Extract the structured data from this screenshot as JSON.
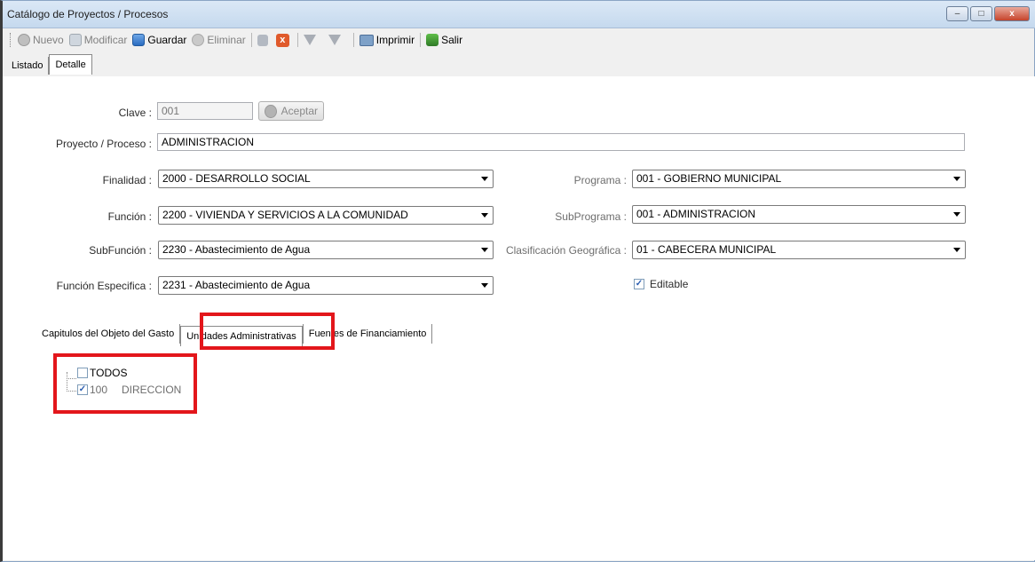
{
  "window": {
    "title": "Catálogo de Proyectos / Procesos",
    "controls": {
      "minimize": "–",
      "maximize": "□",
      "close": "x"
    }
  },
  "toolbar": {
    "nuevo": "Nuevo",
    "modificar": "Modificar",
    "guardar": "Guardar",
    "eliminar": "Eliminar",
    "cancel_glyph": "x",
    "imprimir": "Imprimir",
    "salir": "Salir"
  },
  "tabs": {
    "listado": "Listado",
    "detalle": "Detalle"
  },
  "form": {
    "clave_label": "Clave :",
    "clave_value": "001",
    "aceptar": "Aceptar",
    "proyecto_label": "Proyecto / Proceso :",
    "proyecto_value": "ADMINISTRACION",
    "finalidad_label": "Finalidad :",
    "finalidad_value": "2000 - DESARROLLO SOCIAL",
    "funcion_label": "Función :",
    "funcion_value": "2200 - VIVIENDA Y SERVICIOS  A LA COMUNIDAD",
    "subfuncion_label": "SubFunción :",
    "subfuncion_value": "2230 - Abastecimiento de Agua",
    "funcion_especifica_label": "Función Especifica :",
    "funcion_especifica_value": "2231 - Abastecimiento de Agua",
    "programa_label": "Programa :",
    "programa_value": "001 - GOBIERNO MUNICIPAL",
    "subprograma_label": "SubPrograma :",
    "subprograma_value": "001 - ADMINISTRACION",
    "clasificacion_label": "Clasificación Geográfica :",
    "clasificacion_value": "01 - CABECERA MUNICIPAL",
    "editable_label": "Editable",
    "editable_checked": true
  },
  "subtabs": {
    "capitulos": "Capitulos del Objeto del Gasto",
    "unidades": "Unidades Administrativas",
    "fuentes": "Fuentes de Financiamiento"
  },
  "tree": {
    "todos": "TODOS",
    "item_code": "100",
    "item_name": "DIRECCION",
    "check_glyph": "✓"
  },
  "colors": {
    "highlight": "#e3161b",
    "titlebar": "#c5d9ee"
  }
}
